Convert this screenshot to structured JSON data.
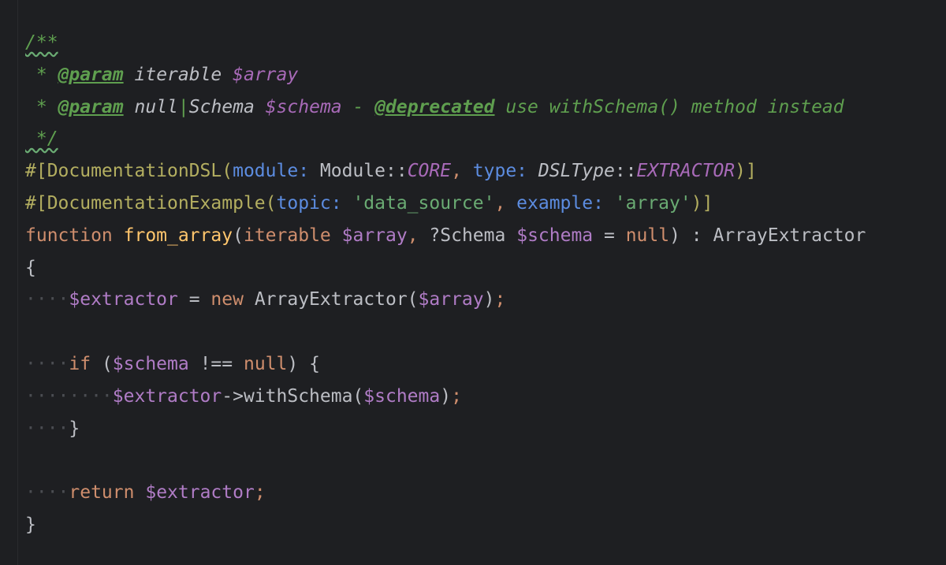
{
  "code_lines": [
    [
      {
        "t": "/**",
        "c": "c-doc wavy"
      }
    ],
    [
      {
        "t": " * ",
        "c": "c-doc"
      },
      {
        "t": "@param",
        "c": "c-tag"
      },
      {
        "t": " ",
        "c": "c-doc"
      },
      {
        "t": "iterable",
        "c": "c-type-doc"
      },
      {
        "t": " ",
        "c": "c-doc"
      },
      {
        "t": "$array",
        "c": "c-var-doc"
      }
    ],
    [
      {
        "t": " * ",
        "c": "c-doc"
      },
      {
        "t": "@param",
        "c": "c-tag"
      },
      {
        "t": " ",
        "c": "c-doc"
      },
      {
        "t": "null",
        "c": "c-type-doc"
      },
      {
        "t": "|",
        "c": "c-pipe"
      },
      {
        "t": "Schema",
        "c": "c-type-doc"
      },
      {
        "t": " ",
        "c": "c-doc"
      },
      {
        "t": "$schema",
        "c": "c-var-doc"
      },
      {
        "t": " - ",
        "c": "c-doc"
      },
      {
        "t": "@deprecated",
        "c": "c-tag"
      },
      {
        "t": " use withSchema() method instead",
        "c": "c-doc"
      }
    ],
    [
      {
        "t": " */",
        "c": "c-doc wavy"
      }
    ],
    [
      {
        "t": "#[DocumentationDSL(",
        "c": "c-attr"
      },
      {
        "t": "module: ",
        "c": "c-param-name"
      },
      {
        "t": "Module",
        "c": "c-class"
      },
      {
        "t": "::",
        "c": "c-plain"
      },
      {
        "t": "CORE",
        "c": "c-const"
      },
      {
        "t": ", ",
        "c": "c-semi"
      },
      {
        "t": "type: ",
        "c": "c-param-name"
      },
      {
        "t": "DSLType",
        "c": "c-type-doc"
      },
      {
        "t": "::",
        "c": "c-plain"
      },
      {
        "t": "EXTRACTOR",
        "c": "c-const"
      },
      {
        "t": ")]",
        "c": "c-attr"
      }
    ],
    [
      {
        "t": "#[DocumentationExample(",
        "c": "c-attr"
      },
      {
        "t": "topic: ",
        "c": "c-param-name"
      },
      {
        "t": "'data_source'",
        "c": "c-string"
      },
      {
        "t": ", ",
        "c": "c-semi"
      },
      {
        "t": "example: ",
        "c": "c-param-name"
      },
      {
        "t": "'array'",
        "c": "c-string"
      },
      {
        "t": ")]",
        "c": "c-attr"
      }
    ],
    [
      {
        "t": "function",
        "c": "c-keyword"
      },
      {
        "t": " ",
        "c": "c-plain"
      },
      {
        "t": "from_array",
        "c": "c-func"
      },
      {
        "t": "(",
        "c": "c-plain"
      },
      {
        "t": "iterable",
        "c": "c-keyword"
      },
      {
        "t": " ",
        "c": "c-plain"
      },
      {
        "t": "$array",
        "c": "c-var"
      },
      {
        "t": ", ",
        "c": "c-semi"
      },
      {
        "t": "?Schema",
        "c": "c-plain"
      },
      {
        "t": " ",
        "c": "c-plain"
      },
      {
        "t": "$schema",
        "c": "c-var"
      },
      {
        "t": " = ",
        "c": "c-plain"
      },
      {
        "t": "null",
        "c": "c-keyword"
      },
      {
        "t": ") : ",
        "c": "c-plain"
      },
      {
        "t": "ArrayExtractor",
        "c": "c-plain"
      }
    ],
    [
      {
        "t": "{",
        "c": "c-plain"
      }
    ],
    [
      {
        "t": "····",
        "c": "c-dot"
      },
      {
        "t": "$extractor",
        "c": "c-var"
      },
      {
        "t": " = ",
        "c": "c-plain"
      },
      {
        "t": "new",
        "c": "c-keyword"
      },
      {
        "t": " ArrayExtractor(",
        "c": "c-plain"
      },
      {
        "t": "$array",
        "c": "c-var"
      },
      {
        "t": ")",
        "c": "c-plain"
      },
      {
        "t": ";",
        "c": "c-semi"
      }
    ],
    [
      {
        "t": "",
        "c": "c-plain"
      }
    ],
    [
      {
        "t": "····",
        "c": "c-dot"
      },
      {
        "t": "if",
        "c": "c-keyword"
      },
      {
        "t": " (",
        "c": "c-plain"
      },
      {
        "t": "$schema",
        "c": "c-var"
      },
      {
        "t": " !== ",
        "c": "c-plain"
      },
      {
        "t": "null",
        "c": "c-keyword"
      },
      {
        "t": ") {",
        "c": "c-plain"
      }
    ],
    [
      {
        "t": "········",
        "c": "c-dot"
      },
      {
        "t": "$extractor",
        "c": "c-var"
      },
      {
        "t": "->withSchema(",
        "c": "c-plain"
      },
      {
        "t": "$schema",
        "c": "c-var"
      },
      {
        "t": ")",
        "c": "c-plain"
      },
      {
        "t": ";",
        "c": "c-semi"
      }
    ],
    [
      {
        "t": "····",
        "c": "c-dot"
      },
      {
        "t": "}",
        "c": "c-plain"
      }
    ],
    [
      {
        "t": "",
        "c": "c-plain"
      }
    ],
    [
      {
        "t": "····",
        "c": "c-dot"
      },
      {
        "t": "return",
        "c": "c-keyword"
      },
      {
        "t": " ",
        "c": "c-plain"
      },
      {
        "t": "$extractor",
        "c": "c-var"
      },
      {
        "t": ";",
        "c": "c-semi"
      }
    ],
    [
      {
        "t": "}",
        "c": "c-plain"
      }
    ]
  ]
}
